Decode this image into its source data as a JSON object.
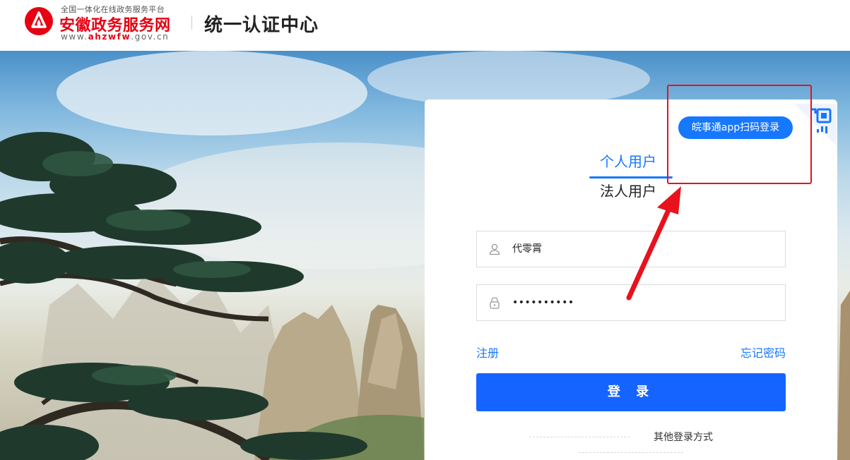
{
  "header": {
    "logo_subtitle": "全国一体化在线政务服务平台",
    "logo_name": "安徽政务服务网",
    "logo_url_prefix": "www.",
    "logo_url_brand": "ahzwfw",
    "logo_url_suffix": ".gov.cn",
    "page_title": "统一认证中心"
  },
  "login": {
    "qr_tooltip": "皖事通app扫码登录",
    "tabs": [
      {
        "label": "个人用户",
        "active": true
      },
      {
        "label": "法人用户",
        "active": false
      }
    ],
    "username_value": "代零霄",
    "password_masked": "••••••••••",
    "register_link": "注册",
    "forgot_link": "忘记密码",
    "login_button": "登 录",
    "other_methods": "其他登录方式"
  },
  "icons": {
    "logo": "logo-icon",
    "qr": "qr-code-icon",
    "user": "user-icon",
    "lock": "lock-icon"
  },
  "colors": {
    "brand_red": "#e60012",
    "accent_blue": "#1677ff",
    "button_blue": "#1664ff",
    "annotation_red": "#e8121c"
  }
}
